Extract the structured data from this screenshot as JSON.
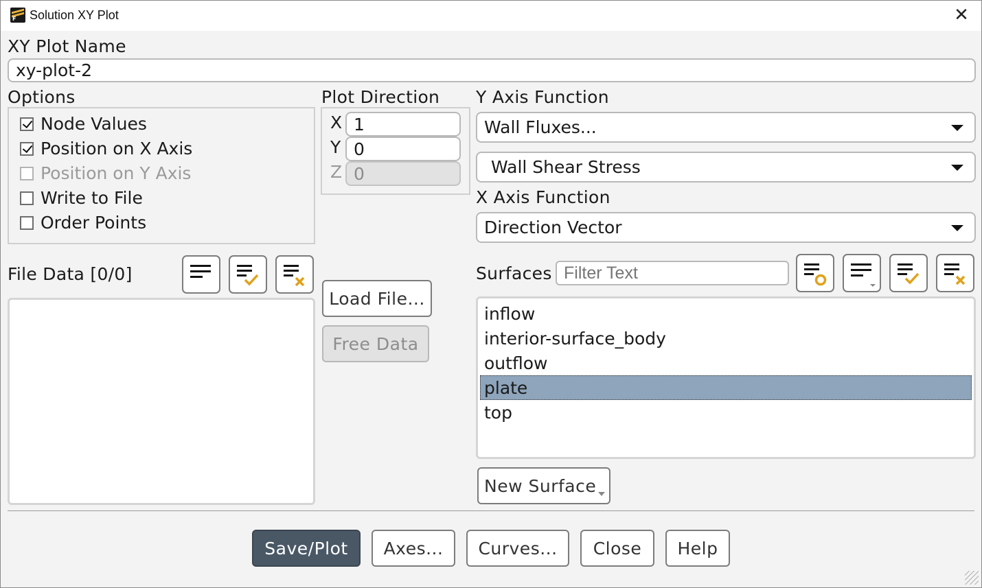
{
  "window": {
    "title": "Solution XY Plot",
    "close": "✕"
  },
  "plot_name": {
    "label": "XY Plot Name",
    "value": "xy-plot-2"
  },
  "options": {
    "label": "Options",
    "items": [
      {
        "label": "Node Values",
        "checked": true,
        "enabled": true
      },
      {
        "label": "Position on X Axis",
        "checked": true,
        "enabled": true
      },
      {
        "label": "Position on Y Axis",
        "checked": false,
        "enabled": false
      },
      {
        "label": "Write to File",
        "checked": false,
        "enabled": true
      },
      {
        "label": "Order Points",
        "checked": false,
        "enabled": true
      }
    ]
  },
  "plot_direction": {
    "label": "Plot Direction",
    "x": {
      "label": "X",
      "value": "1"
    },
    "y": {
      "label": "Y",
      "value": "0"
    },
    "z": {
      "label": "Z",
      "value": "0"
    }
  },
  "y_axis": {
    "label": "Y Axis Function",
    "category": "Wall Fluxes...",
    "function": "Wall Shear Stress"
  },
  "x_axis": {
    "label": "X Axis Function",
    "function": "Direction Vector"
  },
  "file_data": {
    "label": "File Data [0/0]",
    "load_button": "Load File...",
    "free_button": "Free Data"
  },
  "surfaces": {
    "label": "Surfaces",
    "filter_placeholder": "Filter Text",
    "items": [
      "inflow",
      "interior-surface_body",
      "outflow",
      "plate",
      "top"
    ],
    "selected": "plate",
    "new_surface_button": "New Surface"
  },
  "footer": {
    "save_plot": "Save/Plot",
    "axes": "Axes...",
    "curves": "Curves...",
    "close": "Close",
    "help": "Help"
  },
  "colors": {
    "primary_button": "#4a5866",
    "selection": "#8ea5bb",
    "icon_accent": "#e0a21b"
  }
}
